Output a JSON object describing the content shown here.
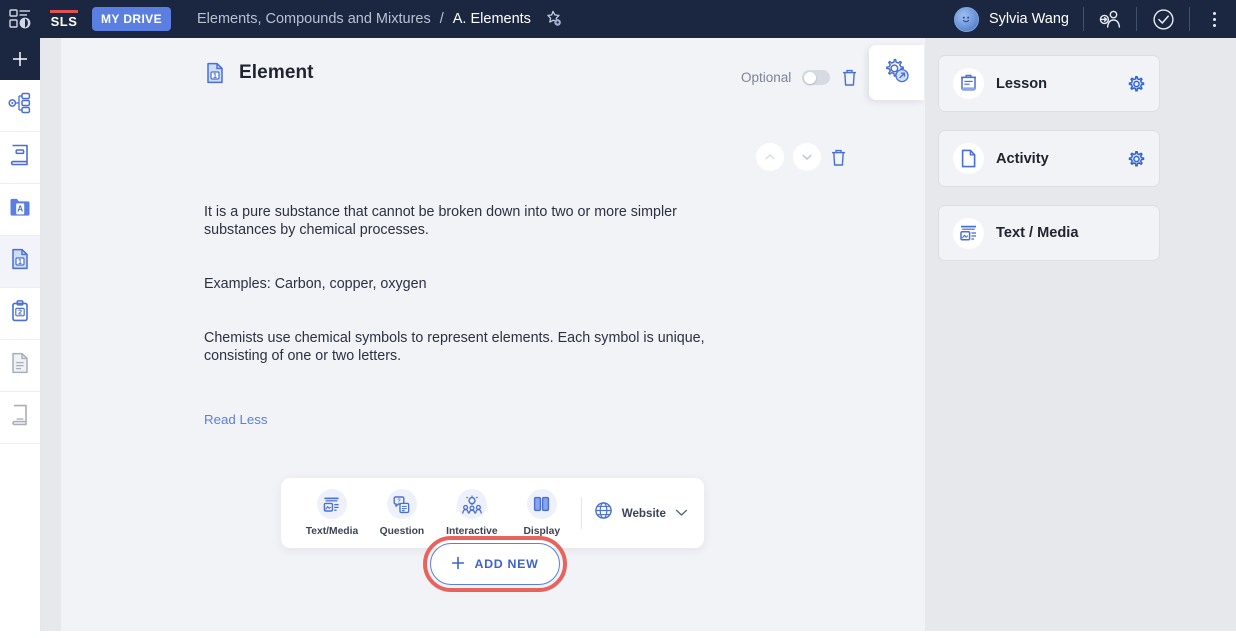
{
  "topbar": {
    "menu_icon": "app-menu-icon",
    "logo_text": "SLS",
    "my_drive_label": "MY DRIVE",
    "breadcrumb": {
      "parent": "Elements, Compounds and Mixtures",
      "separator": "/",
      "current": "A. Elements",
      "star_icon": "star-gear-icon"
    },
    "user": {
      "name": "Sylvia Wang",
      "avatar_icon": "avatar-smiley-icon"
    },
    "actions": {
      "share_icon": "share-person-icon",
      "check_icon": "check-circle-icon",
      "more_icon": "kebab-more-icon"
    }
  },
  "rail": {
    "add_label": "+",
    "items": [
      {
        "name": "settings-tree",
        "icon": "gear-tree-icon",
        "active": false
      },
      {
        "name": "notebook",
        "icon": "notebook-icon",
        "active": false
      },
      {
        "name": "folder-a",
        "icon": "folder-a-icon",
        "active": false
      },
      {
        "name": "page-1",
        "icon": "page-one-icon",
        "active": true
      },
      {
        "name": "clipboard-2",
        "icon": "clipboard-two-icon",
        "active": false
      },
      {
        "name": "document",
        "icon": "document-lines-icon",
        "active": false
      },
      {
        "name": "book",
        "icon": "book-icon",
        "active": false
      }
    ]
  },
  "card": {
    "icon": "page-one-icon",
    "title": "Element",
    "optional_label": "Optional",
    "optional_on": false,
    "delete_icon": "trash-icon",
    "settings_icon": "gear-expand-icon",
    "move_up_icon": "chevron-up-icon",
    "move_down_icon": "chevron-down-icon",
    "row_delete_icon": "trash-icon",
    "paragraphs": [
      "It is a pure substance that cannot be broken down into two or more simpler substances by chemical processes.",
      "Examples: Carbon, copper, oxygen",
      "Chemists use chemical symbols to represent elements. Each symbol is unique, consisting of one or two letters."
    ],
    "read_less_label": "Read Less"
  },
  "tools": {
    "items": [
      {
        "label": "Text/Media",
        "icon": "text-media-icon"
      },
      {
        "label": "Question",
        "icon": "question-bubble-icon"
      },
      {
        "label": "Interactive",
        "icon": "interactive-people-icon"
      },
      {
        "label": "Display",
        "icon": "display-columns-icon"
      }
    ],
    "website": {
      "label": "Website",
      "globe_icon": "globe-icon",
      "chevron_icon": "chevron-down-icon"
    }
  },
  "add_new": {
    "label": "ADD NEW",
    "plus_icon": "plus-icon",
    "highlight_color": "#e8635e"
  },
  "panel": {
    "cards": [
      {
        "label": "Lesson",
        "icon": "lesson-clipboard-icon",
        "gear_icon": "gear-icon",
        "has_gear": true
      },
      {
        "label": "Activity",
        "icon": "activity-page-icon",
        "gear_icon": "gear-icon",
        "has_gear": true
      },
      {
        "label": "Text / Media",
        "icon": "text-media-icon",
        "gear_icon": null,
        "has_gear": false
      }
    ]
  },
  "colors": {
    "topbar": "#1b2740",
    "accent_blue": "#5b7fe0",
    "content_bg": "#f2f3f7",
    "panel_bg": "#e7e8eb",
    "highlight_red": "#e8635e"
  }
}
